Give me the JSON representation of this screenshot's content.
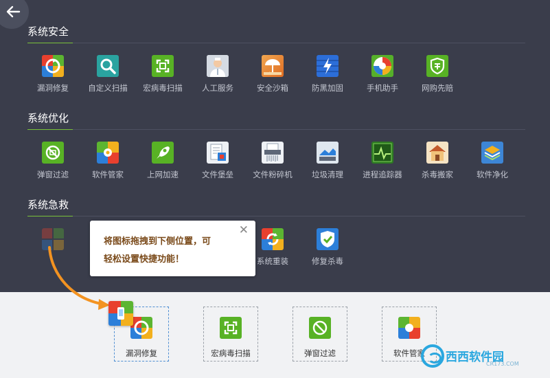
{
  "sections": [
    {
      "title": "系统安全",
      "tools": [
        {
          "label": "漏洞修复",
          "icon": "patch-repair-icon"
        },
        {
          "label": "自定义扫描",
          "icon": "magnifier-icon"
        },
        {
          "label": "宏病毒扫描",
          "icon": "scan-frame-icon"
        },
        {
          "label": "人工服务",
          "icon": "doctor-icon"
        },
        {
          "label": "安全沙箱",
          "icon": "sandbox-umbrella-icon"
        },
        {
          "label": "防黑加固",
          "icon": "lightning-shield-icon"
        },
        {
          "label": "手机助手",
          "icon": "phone-assistant-icon"
        },
        {
          "label": "网购先赔",
          "icon": "shopping-shield-icon"
        }
      ]
    },
    {
      "title": "系统优化",
      "tools": [
        {
          "label": "弹窗过滤",
          "icon": "popup-block-icon"
        },
        {
          "label": "软件管家",
          "icon": "software-manager-icon"
        },
        {
          "label": "上网加速",
          "icon": "rocket-icon"
        },
        {
          "label": "文件堡垒",
          "icon": "file-vault-icon"
        },
        {
          "label": "文件粉碎机",
          "icon": "shredder-icon"
        },
        {
          "label": "垃圾清理",
          "icon": "cleanup-icon"
        },
        {
          "label": "进程追踪器",
          "icon": "process-monitor-icon"
        },
        {
          "label": "杀毒搬家",
          "icon": "move-house-icon"
        },
        {
          "label": "软件净化",
          "icon": "layers-icon"
        }
      ]
    },
    {
      "title": "系统急救",
      "tools": [
        {
          "label": "系统重装",
          "icon": "reinstall-icon"
        },
        {
          "label": "修复杀毒",
          "icon": "repair-shield-icon"
        }
      ]
    }
  ],
  "tooltip": {
    "line1": "将图标拖拽到下侧位置，可",
    "line2": "轻松设置快捷功能！",
    "close": "✕"
  },
  "shortcuts": [
    {
      "label": "漏洞修复",
      "icon": "patch-repair-icon"
    },
    {
      "label": "宏病毒扫描",
      "icon": "scan-frame-icon"
    },
    {
      "label": "弹窗过滤",
      "icon": "popup-block-icon"
    },
    {
      "label": "软件管家",
      "icon": "software-manager-icon"
    }
  ],
  "watermark": {
    "text": "西西软件园",
    "sub": "CR173.COM"
  },
  "colors": {
    "accent": "#7ac23a",
    "dark_bg": "#3a3d4b",
    "light_bg": "#f1f2f4"
  }
}
